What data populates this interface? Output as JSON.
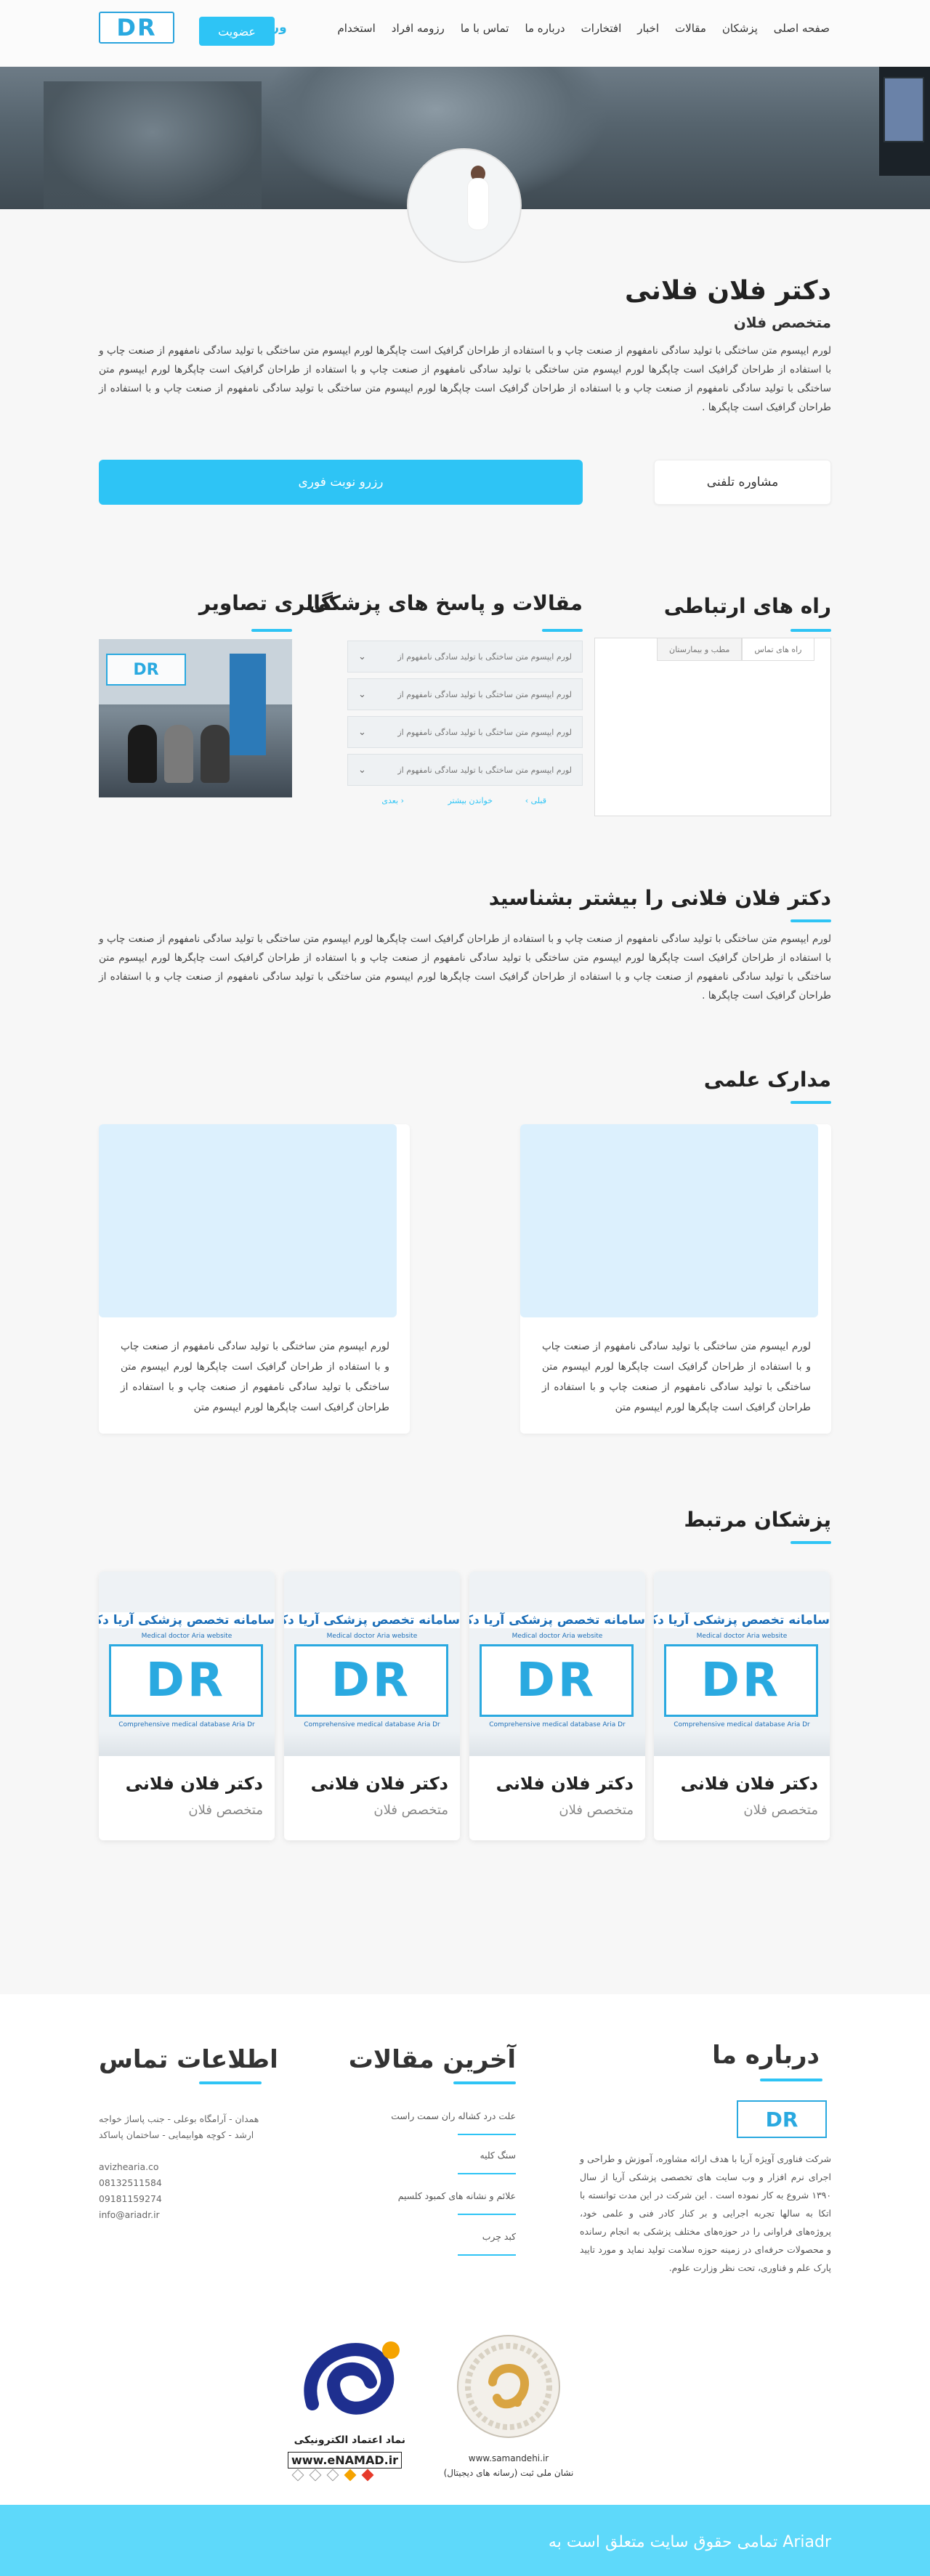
{
  "nav": {
    "items": [
      "صفحه اصلی",
      "پزشکان",
      "مقالات",
      "اخبار",
      "افتخارات",
      "درباره ما",
      "تماس با ما",
      "رزومه افراد",
      "استخدام"
    ],
    "login": "ورود",
    "signup": "عضویت",
    "logo_text": "DR"
  },
  "profile": {
    "name": "دکتر فلان فلانی",
    "specialty": "متخصص فلان",
    "bio": "لورم ایپسوم متن ساختگی با تولید سادگی نامفهوم از صنعت چاپ و با استفاده از طراحان گرافیک است چاپگرها لورم ایپسوم متن ساختگی با تولید سادگی نامفهوم از صنعت چاپ و با استفاده از طراحان گرافیک است چاپگرها لورم ایپسوم متن ساختگی با تولید سادگی نامفهوم از صنعت چاپ و با استفاده از طراحان گرافیک است چاپگرها لورم ایپسوم متن ساختگی با تولید سادگی نامفهوم از صنعت چاپ و با استفاده از طراحان گرافیک است چاپگرها لورم ایپسوم متن ساختگی با تولید سادگی نامفهوم از صنعت چاپ و با استفاده از طراحان گرافیک است چاپگرها .",
    "btn_call": "مشاوره تلفنی",
    "btn_reserve": "رزرو نوبت فوری"
  },
  "contact_section": {
    "title": "راه های ارتباطی",
    "tab_active": "راه های تماس",
    "tab_inactive": "مطب و بیمارستان"
  },
  "faq": {
    "title": "مقالات و پاسخ های پزشکی",
    "items": [
      "لورم ایپسوم متن ساختگی با تولید سادگی نامفهوم از",
      "لورم ایپسوم متن ساختگی با تولید سادگی نامفهوم از",
      "لورم ایپسوم متن ساختگی با تولید سادگی نامفهوم از",
      "لورم ایپسوم متن ساختگی با تولید سادگی نامفهوم از"
    ],
    "prev": "قبلی ›",
    "more": "خواندن بیشتر",
    "next": "‹ بعدی"
  },
  "gallery": {
    "title": "گالری تصاویر",
    "logo_text": "DR"
  },
  "about_doctor": {
    "title": "دکتر فلان فلانی را بیشتر بشناسید",
    "text": "لورم ایپسوم متن ساختگی با تولید سادگی نامفهوم از صنعت چاپ و با استفاده از طراحان گرافیک است چاپگرها لورم ایپسوم متن ساختگی با تولید سادگی نامفهوم از صنعت چاپ و با استفاده از طراحان گرافیک است چاپگرها لورم ایپسوم متن ساختگی با تولید سادگی نامفهوم از صنعت چاپ و با استفاده از طراحان گرافیک است چاپگرها لورم ایپسوم متن ساختگی با تولید سادگی نامفهوم از صنعت چاپ و با استفاده از طراحان گرافیک است چاپگرها لورم ایپسوم متن ساختگی با تولید سادگی نامفهوم از صنعت چاپ و با استفاده از طراحان گرافیک است چاپگرها ."
  },
  "certificates": {
    "title": "مدارک علمی",
    "items": [
      "لورم ایپسوم متن ساختگی با تولید سادگی نامفهوم از صنعت چاپ و با استفاده از طراحان گرافیک است چاپگرها لورم ایپسوم متن ساختگی با تولید سادگی نامفهوم از صنعت چاپ و با استفاده از طراحان گرافیک است چاپگرها لورم ایپسوم متن",
      "لورم ایپسوم متن ساختگی با تولید سادگی نامفهوم از صنعت چاپ و با استفاده از طراحان گرافیک است چاپگرها لورم ایپسوم متن ساختگی با تولید سادگی نامفهوم از صنعت چاپ و با استفاده از طراحان گرافیک است چاپگرها لورم ایپسوم متن"
    ]
  },
  "related": {
    "title": "پزشکان مرتبط",
    "banner": "سامانه تخصص پزشکی آریا دکتر",
    "banner_sub": "Medical doctor Aria website",
    "logo_text": "DR",
    "logo_sub": "Comprehensive medical database Aria Dr",
    "doctors": [
      {
        "name": "دکتر فلان فلانی",
        "specialty": "متخصص فلان"
      },
      {
        "name": "دکتر فلان فلانی",
        "specialty": "متخصص فلان"
      },
      {
        "name": "دکتر فلان فلانی",
        "specialty": "متخصص فلان"
      },
      {
        "name": "دکتر فلان فلانی",
        "specialty": "متخصص فلان"
      }
    ]
  },
  "footer": {
    "about_title": "درباره ما",
    "about_logo": "DR",
    "about_text": "شرکت فناوری آویژه آریا با هدف ارائه مشاوره، آموزش و طراحی و اجرای نرم افزار و وب سایت های تخصصی پزشکی آریا از سال ۱۳۹۰ شروع به کار نموده است . این شرکت در این مدت توانسته با اتکا به سالها تجربه اجرایی و بر کنار کادر فنی و علمی خود، پروژه‌های فراوانی را در حوزه‌های مختلف پزشکی به انجام رسانده و محصولات حرفه‌ای در زمینه حوزه سلامت تولید نماید و مورد تایید پارک علم و فناوری، تحت نظر وزارت علوم.",
    "articles_title": "آخرین مقالات",
    "articles": [
      "علت درد کشاله ران سمت راست",
      "سنگ کلیه",
      "علائم و نشانه های کمبود کلسیم",
      "کبد چرب"
    ],
    "contact_title": "اطلاعات تماس",
    "contact_lines": [
      "همدان - آرامگاه بوعلی - جنب پاساژ خواجه",
      "ارشد - کوچه هوابیمایی - ساختمان پاساکد"
    ],
    "contact_web": "avizhearia.co",
    "contact_phone1": "08132511584",
    "contact_phone2": "09181159274",
    "contact_email": "info@ariadr.ir",
    "enamad_label": "نماد اعتماد الکترونیکی",
    "enamad_url": "www.eNAMAD.ir",
    "samandehi_url": "www.samandehi.ir",
    "samandehi_label": "نشان ملی ثبت (رسانه های دیجیتال)",
    "copyright": "Ariadr   تمامی حقوق سایت متعلق است به"
  }
}
